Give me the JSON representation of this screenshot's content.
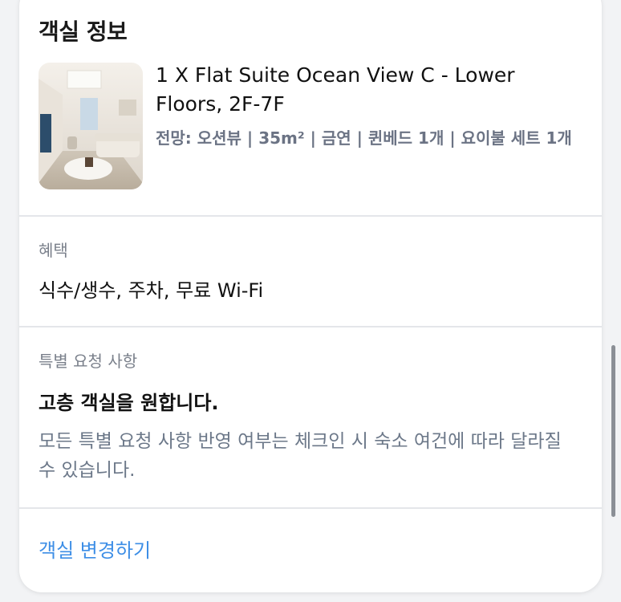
{
  "room_info": {
    "title": "객실 정보",
    "room_name": "1 X Flat Suite Ocean View C - Lower Floors, 2F-7F",
    "room_details": "전망: 오션뷰 | 35m² | 금연 | 퀸베드 1개 | 요이불 세트 1개",
    "thumbnail_alt": "room-photo"
  },
  "benefits": {
    "label": "혜택",
    "value": "식수/생수, 주차, 무료 Wi-Fi"
  },
  "special_request": {
    "label": "특별 요청 사항",
    "request": "고층 객실을 원합니다.",
    "notice": "모든 특별 요청 사항 반영 여부는 체크인 시 숙소 여건에 따라 달라질 수 있습니다."
  },
  "actions": {
    "change_room": "객실 변경하기"
  },
  "colors": {
    "link": "#3d8ee6",
    "muted_text": "#6c7889",
    "divider": "#e4e6ea"
  }
}
